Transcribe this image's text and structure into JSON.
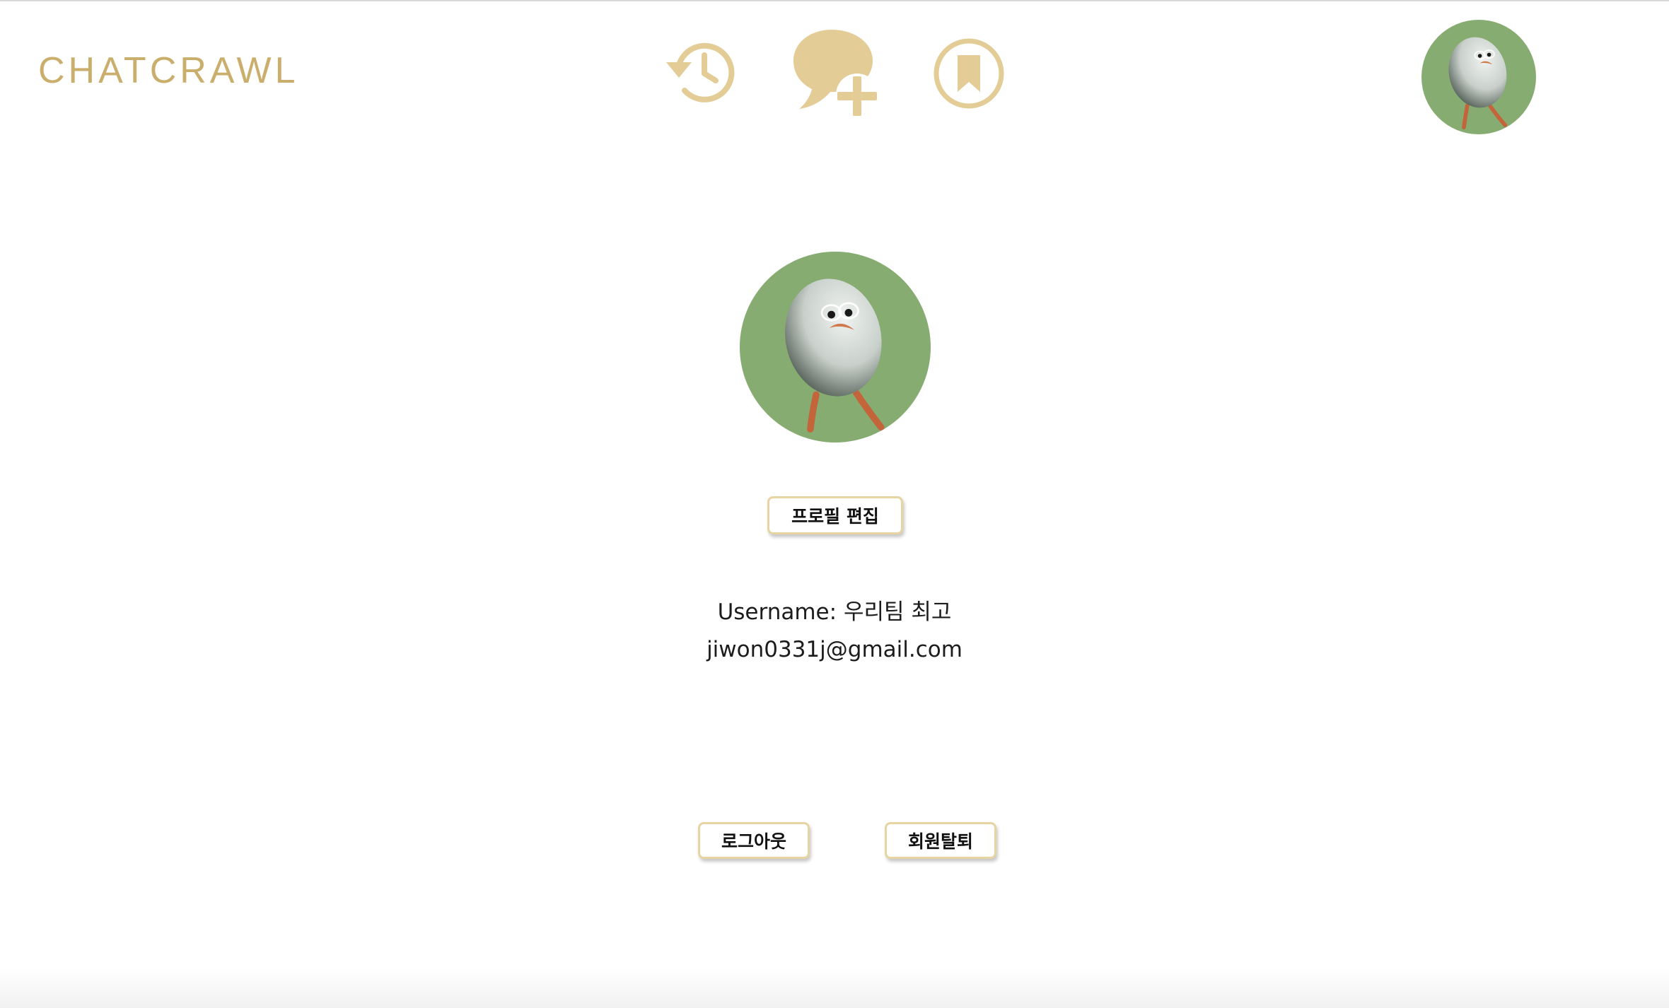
{
  "header": {
    "logo_text": "CHATCRAWL",
    "icons": {
      "history": "history-icon",
      "new_chat": "new-chat-icon",
      "bookmark": "bookmark-icon"
    },
    "avatar": "profile-avatar"
  },
  "profile": {
    "avatar": "profile-avatar",
    "edit_button_label": "프로필 편집",
    "username_label": "Username:",
    "username_value": "우리팀 최고",
    "email": "jiwon0331j@gmail.com"
  },
  "actions": {
    "logout_label": "로그아웃",
    "withdraw_label": "회원탈퇴"
  },
  "colors": {
    "accent": "#c9ae6c",
    "icon_fill": "#e3cc96",
    "avatar_bg": "#86ac72",
    "button_border": "#e6d4a3"
  }
}
